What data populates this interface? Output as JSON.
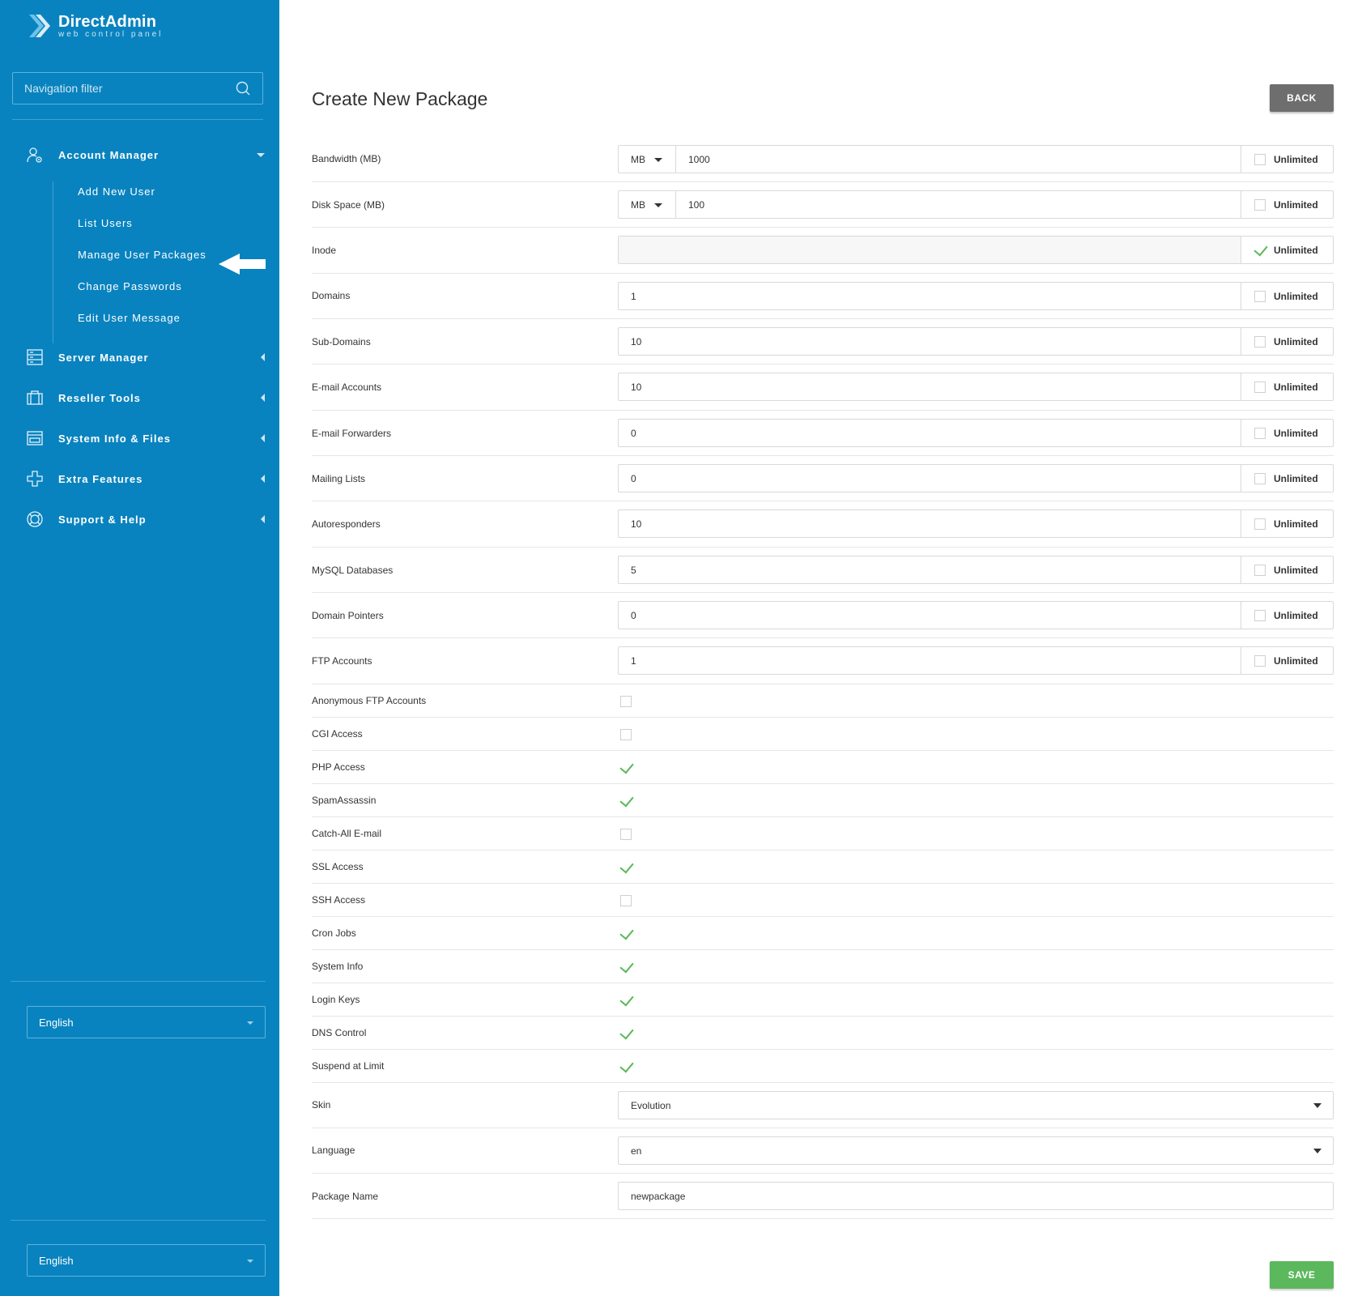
{
  "brand": {
    "name": "DirectAdmin",
    "tagline": "web control panel"
  },
  "sidebar": {
    "nav_filter_placeholder": "Navigation filter",
    "sections": [
      {
        "label": "Account Manager",
        "icon": "user-gear-icon",
        "expanded": true
      },
      {
        "label": "Server Manager",
        "icon": "server-icon",
        "expanded": false
      },
      {
        "label": "Reseller Tools",
        "icon": "briefcase-icon",
        "expanded": false
      },
      {
        "label": "System Info & Files",
        "icon": "folder-icon",
        "expanded": false
      },
      {
        "label": "Extra Features",
        "icon": "plus-icon",
        "expanded": false
      },
      {
        "label": "Support & Help",
        "icon": "lifebuoy-icon",
        "expanded": false
      }
    ],
    "account_manager_items": [
      "Add New User",
      "List Users",
      "Manage User Packages",
      "Change Passwords",
      "Edit User Message"
    ],
    "language_top": "English",
    "language_bottom": "English"
  },
  "main": {
    "title": "Create New Package",
    "back_label": "BACK",
    "save_label": "SAVE",
    "unlimited_label": "Unlimited",
    "limits": [
      {
        "label": "Bandwidth (MB)",
        "unit": "MB",
        "value": "1000",
        "unlimited": false
      },
      {
        "label": "Disk Space (MB)",
        "unit": "MB",
        "value": "100",
        "unlimited": false
      },
      {
        "label": "Inode",
        "value": "",
        "unlimited": true
      },
      {
        "label": "Domains",
        "value": "1",
        "unlimited": false
      },
      {
        "label": "Sub-Domains",
        "value": "10",
        "unlimited": false
      },
      {
        "label": "E-mail Accounts",
        "value": "10",
        "unlimited": false
      },
      {
        "label": "E-mail Forwarders",
        "value": "0",
        "unlimited": false
      },
      {
        "label": "Mailing Lists",
        "value": "0",
        "unlimited": false
      },
      {
        "label": "Autoresponders",
        "value": "10",
        "unlimited": false
      },
      {
        "label": "MySQL Databases",
        "value": "5",
        "unlimited": false
      },
      {
        "label": "Domain Pointers",
        "value": "0",
        "unlimited": false
      },
      {
        "label": "FTP Accounts",
        "value": "1",
        "unlimited": false
      }
    ],
    "features": [
      {
        "label": "Anonymous FTP Accounts",
        "checked": false
      },
      {
        "label": "CGI Access",
        "checked": false
      },
      {
        "label": "PHP Access",
        "checked": true
      },
      {
        "label": "SpamAssassin",
        "checked": true
      },
      {
        "label": "Catch-All E-mail",
        "checked": false
      },
      {
        "label": "SSL Access",
        "checked": true
      },
      {
        "label": "SSH Access",
        "checked": false
      },
      {
        "label": "Cron Jobs",
        "checked": true
      },
      {
        "label": "System Info",
        "checked": true
      },
      {
        "label": "Login Keys",
        "checked": true
      },
      {
        "label": "DNS Control",
        "checked": true
      },
      {
        "label": "Suspend at Limit",
        "checked": true
      }
    ],
    "skin": {
      "label": "Skin",
      "value": "Evolution"
    },
    "language": {
      "label": "Language",
      "value": "en"
    },
    "package_name": {
      "label": "Package Name",
      "value": "newpackage"
    }
  },
  "colors": {
    "sidebar_bg": "#0983bf",
    "save_green": "#5cb85c",
    "back_gray": "#6e6e6e",
    "check_green": "#5cb85c"
  }
}
